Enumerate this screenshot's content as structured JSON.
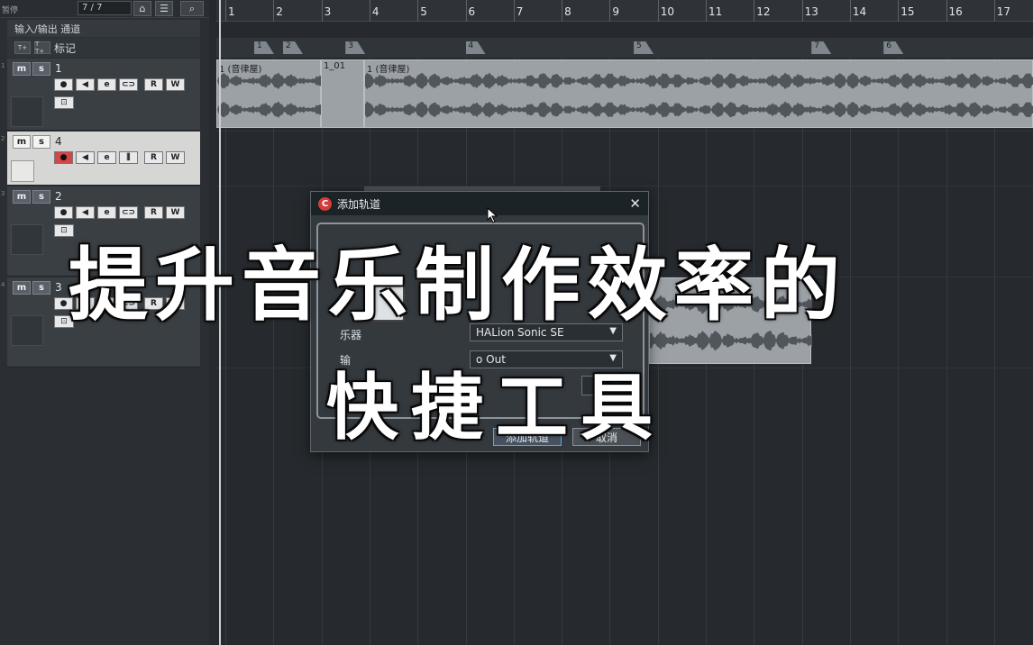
{
  "toolbar": {
    "label": "暂停",
    "track_count": "7 / 7",
    "btn_visibility": "⌂",
    "btn_list": "☰",
    "btn_search": "⌕"
  },
  "io_row": {
    "label": "输入/输出 通道"
  },
  "marker_track": {
    "btn_a": "T+",
    "btn_b": "T T+",
    "label": "标记"
  },
  "tracks": [
    {
      "id": "t1",
      "num": "1",
      "name": "1",
      "m": "m",
      "s": "s",
      "buttons": [
        "●",
        "◀",
        "e",
        "⊂⊃",
        "R",
        "W"
      ],
      "lock": "⊡",
      "selected": false
    },
    {
      "id": "t4",
      "num": "2",
      "name": "4",
      "m": "m",
      "s": "s",
      "buttons": [
        "●",
        "◀",
        "e",
        "⫼",
        "R",
        "W"
      ],
      "lock": "",
      "selected": true
    },
    {
      "id": "t2",
      "num": "3",
      "name": "2",
      "m": "m",
      "s": "s",
      "buttons": [
        "●",
        "◀",
        "e",
        "⊂⊃",
        "R",
        "W"
      ],
      "lock": "⊡",
      "selected": false
    },
    {
      "id": "t3",
      "num": "4",
      "name": "3",
      "m": "m",
      "s": "s",
      "buttons": [
        "●",
        "◀",
        "e",
        "⊂⊃",
        "R",
        "W"
      ],
      "lock": "⊡",
      "selected": false
    }
  ],
  "ruler": {
    "bars": [
      "1",
      "2",
      "3",
      "4",
      "5",
      "6",
      "7",
      "8",
      "9",
      "10",
      "11",
      "12",
      "13",
      "14",
      "15",
      "16",
      "17"
    ]
  },
  "markers": [
    "1",
    "2",
    "3",
    "4",
    "5",
    "7",
    "6"
  ],
  "events": {
    "e1": "1 (音律屋)",
    "e2": "1_01",
    "e3": "1 (音律屋)"
  },
  "dialog": {
    "title": "添加轨道",
    "close": "✕",
    "instrument_label": "乐器",
    "instrument_value": "HALion Sonic SE",
    "output_label": "输",
    "output_value": "o Out",
    "count_label": "数",
    "count_value": "1",
    "add_button": "添加轨道",
    "cancel_button": "取消"
  },
  "overlay": {
    "line1": "提升音乐制作效率的",
    "line2": "快捷工具"
  }
}
